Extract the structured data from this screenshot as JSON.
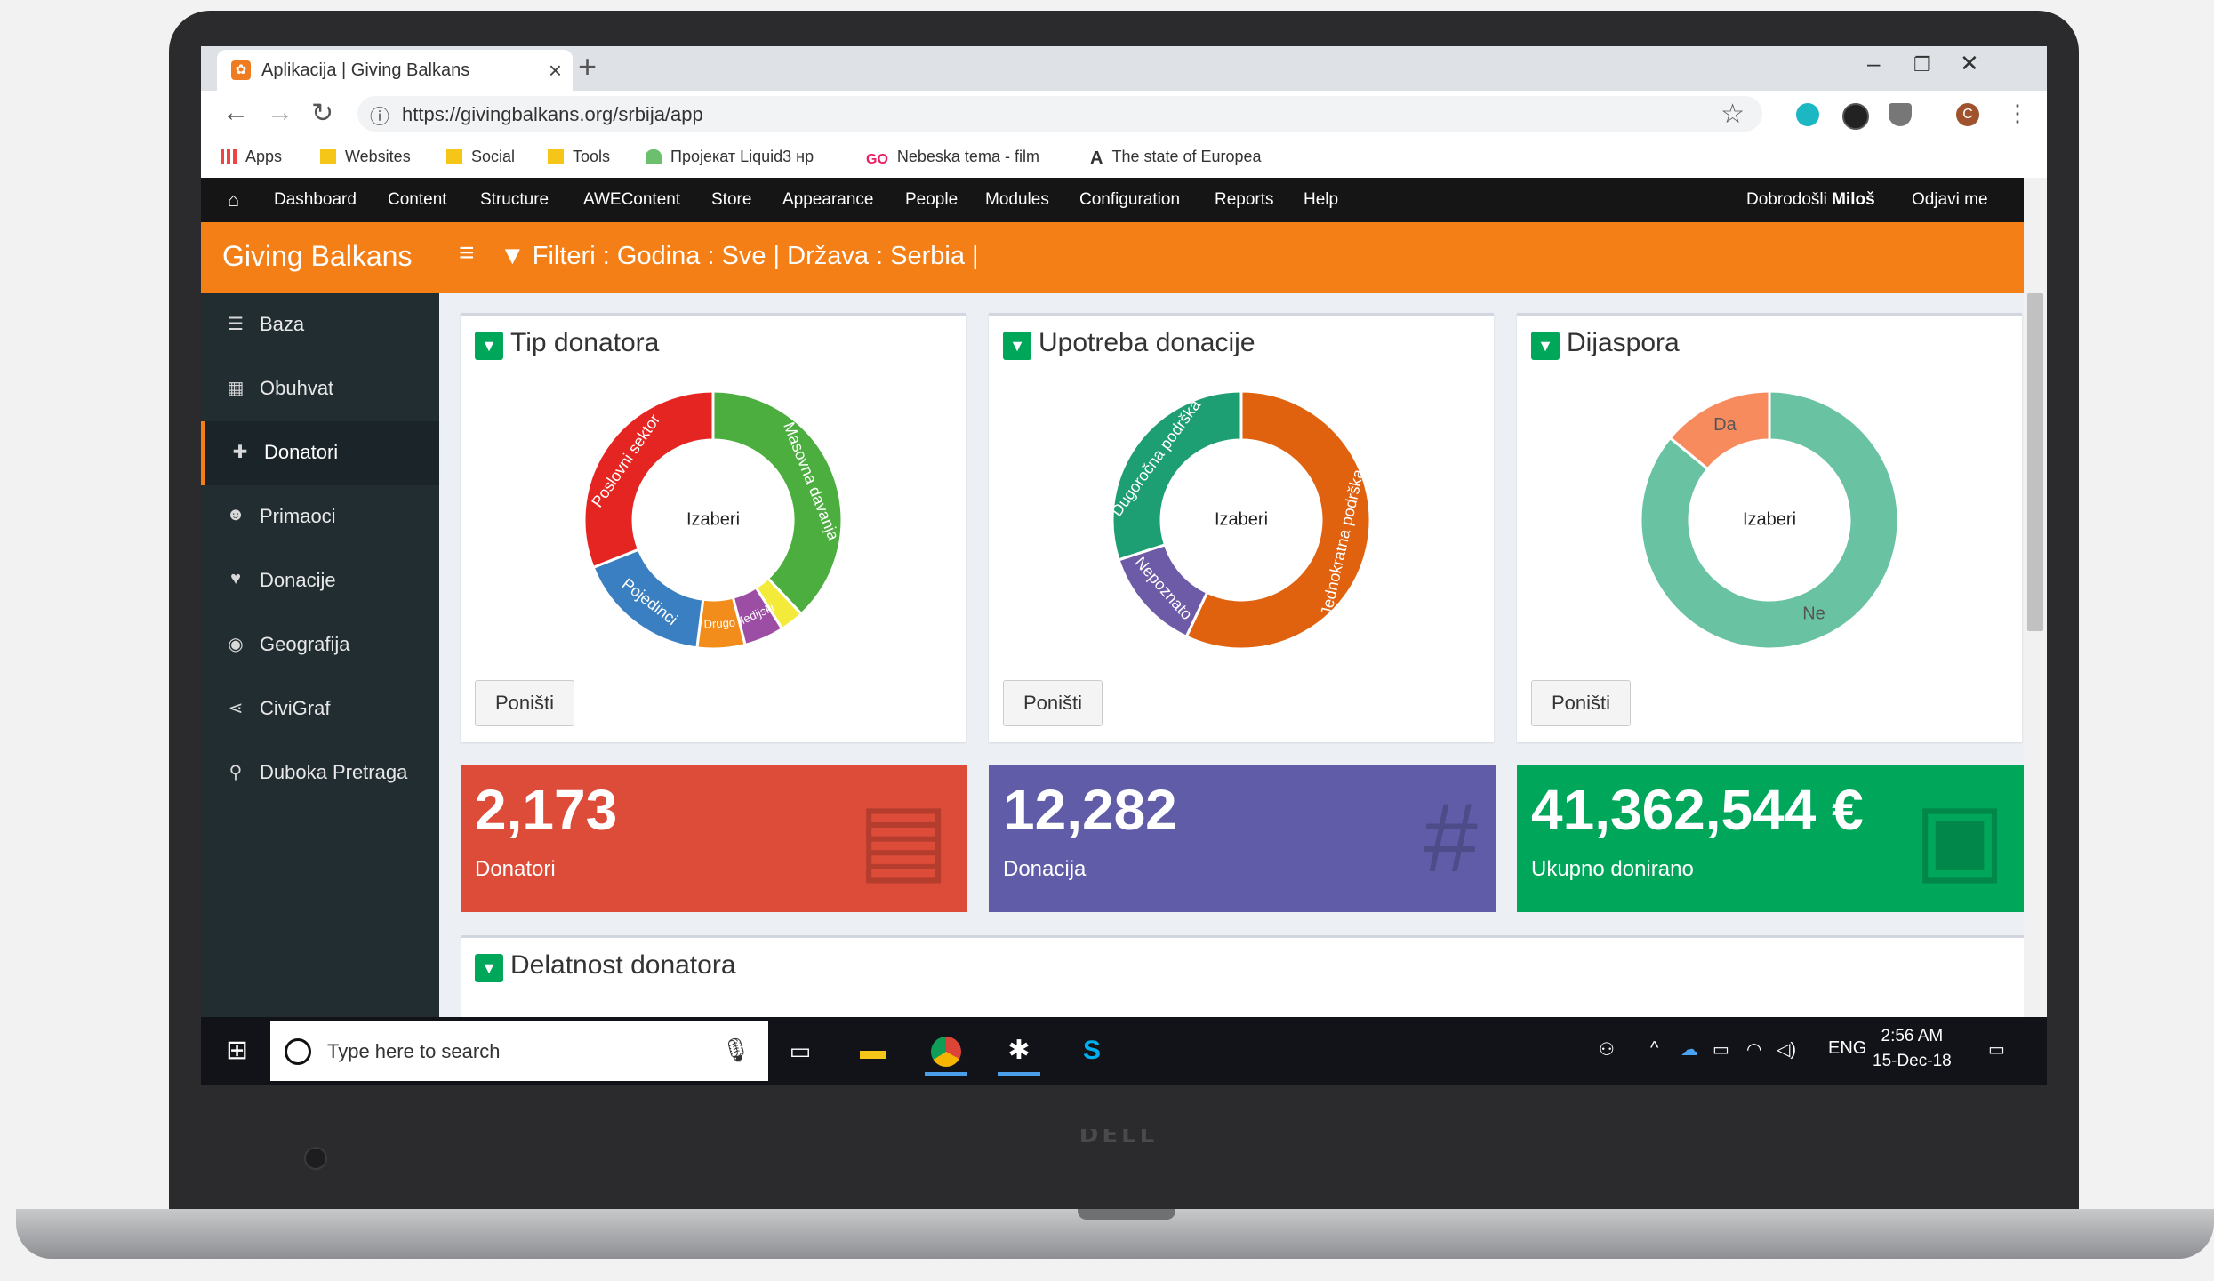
{
  "browser": {
    "tab_title": "Aplikacija | Giving Balkans",
    "url": "https://givingbalkans.org/srbija/app",
    "new_tab_symbol": "+",
    "bookmarks": [
      "Apps",
      "Websites",
      "Social",
      "Tools",
      "Пројекат Liquid3 нр",
      "Nebeska tema - film",
      "The state of Europea"
    ]
  },
  "admin_menu": {
    "items": [
      "Dashboard",
      "Content",
      "Structure",
      "AWEContent",
      "Store",
      "Appearance",
      "People",
      "Modules",
      "Configuration",
      "Reports",
      "Help"
    ],
    "welcome": "Dobrodošli",
    "username": "Miloš",
    "logout": "Odjavi me"
  },
  "header": {
    "brand": "Giving Balkans",
    "filter_text": "Filteri : Godina : Sve | Država : Serbia |"
  },
  "sidebar": {
    "items": [
      {
        "label": "Baza",
        "icon": "database-icon"
      },
      {
        "label": "Obuhvat",
        "icon": "map-icon"
      },
      {
        "label": "Donatori",
        "icon": "gift-icon"
      },
      {
        "label": "Primaoci",
        "icon": "users-icon"
      },
      {
        "label": "Donacije",
        "icon": "heart-icon"
      },
      {
        "label": "Geografija",
        "icon": "globe-icon"
      },
      {
        "label": "CiviGraf",
        "icon": "share-icon"
      },
      {
        "label": "Duboka Pretraga",
        "icon": "search-icon"
      }
    ],
    "active": "Donatori"
  },
  "panels": [
    {
      "title": "Tip donatora",
      "center_label": "Izaberi",
      "reset_label": "Poništi"
    },
    {
      "title": "Upotreba donacije",
      "center_label": "Izaberi",
      "reset_label": "Poništi"
    },
    {
      "title": "Dijaspora",
      "center_label": "Izaberi",
      "reset_label": "Poništi"
    }
  ],
  "chart_data": [
    {
      "type": "pie",
      "title": "Tip donatora",
      "slices": [
        {
          "label": "Masovna davanja",
          "value": 38,
          "color": "#4cae3f"
        },
        {
          "label": "",
          "value": 3,
          "color": "#f3ea39"
        },
        {
          "label": "Medijski",
          "value": 5,
          "color": "#9c4ea4"
        },
        {
          "label": "Drugo",
          "value": 6,
          "color": "#f28d1b"
        },
        {
          "label": "Pojedinci",
          "value": 17,
          "color": "#3a7fc1"
        },
        {
          "label": "Poslovni sektor",
          "value": 31,
          "color": "#e52521"
        }
      ]
    },
    {
      "type": "pie",
      "title": "Upotreba donacije",
      "slices": [
        {
          "label": "Jednokratna podrška",
          "value": 57,
          "color": "#e0620f"
        },
        {
          "label": "Nepoznato",
          "value": 13,
          "color": "#6e5ba8"
        },
        {
          "label": "Dugoročna podrška",
          "value": 30,
          "color": "#1e9e73"
        }
      ]
    },
    {
      "type": "pie",
      "title": "Dijaspora",
      "slices": [
        {
          "label": "Ne",
          "value": 86,
          "color": "#69c3a3"
        },
        {
          "label": "Da",
          "value": 14,
          "color": "#f78b5e"
        }
      ]
    }
  ],
  "stats": [
    {
      "value": "2,173",
      "label": "Donatori",
      "color": "#dd4b39",
      "icon": "id-card-icon"
    },
    {
      "value": "12,282",
      "label": "Donacija",
      "color": "#605ca8",
      "icon": "hashtag-icon"
    },
    {
      "value": "41,362,544 €",
      "label": "Ukupno donirano",
      "color": "#00a65a",
      "icon": "money-icon"
    }
  ],
  "lower_panel": {
    "title": "Delatnost donatora"
  },
  "taskbar": {
    "search_placeholder": "Type here to search",
    "language": "ENG",
    "time": "2:56 AM",
    "date": "15-Dec-18"
  },
  "laptop": {
    "brand": "DELL"
  }
}
